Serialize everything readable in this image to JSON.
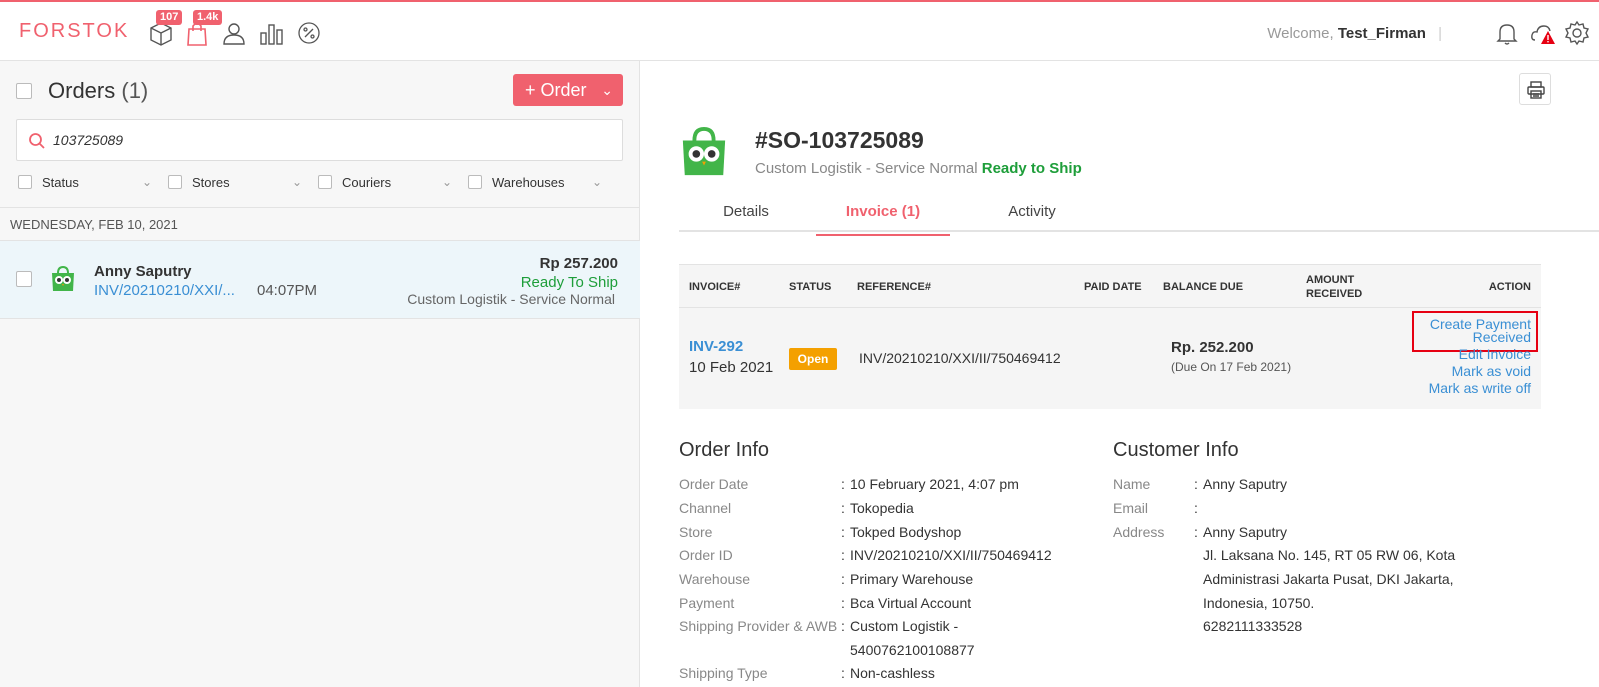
{
  "topbar": {
    "logo": "FORSTOK",
    "badges": {
      "products": "107",
      "orders": "1.4k"
    },
    "welcome_prefix": "Welcome,",
    "user": "Test_Firman",
    "separator": "|"
  },
  "left": {
    "title": "Orders",
    "count": "(1)",
    "order_button": "+ Order",
    "search_value": "103725089",
    "filters": [
      "Status",
      "Stores",
      "Couriers",
      "Warehouses"
    ],
    "date_header": "WEDNESDAY, FEB 10, 2021",
    "order": {
      "customer": "Anny Saputry",
      "invoice": "INV/20210210/XXI/...",
      "time": "04:07PM",
      "amount": "Rp 257.200",
      "status": "Ready To Ship",
      "shipping": "Custom Logistik - Service Normal"
    }
  },
  "detail": {
    "so_number": "#SO-103725089",
    "subtitle": "Custom Logistik - Service Normal",
    "status": "Ready to Ship",
    "tabs": [
      "Details",
      "Invoice (1)",
      "Activity"
    ],
    "invoice_table": {
      "headers": {
        "invoice": "INVOICE#",
        "status": "STATUS",
        "reference": "REFERENCE#",
        "paid_date": "PAID DATE",
        "balance_due": "BALANCE DUE",
        "amount_received_1": "AMOUNT",
        "amount_received_2": "RECEIVED",
        "action": "ACTION"
      },
      "row": {
        "invoice": "INV-292",
        "date": "10 Feb 2021",
        "status": "Open",
        "reference": "INV/20210210/XXI/II/750469412",
        "balance": "Rp. 252.200",
        "due": "(Due On 17 Feb 2021)",
        "actions": {
          "create_1": "Create Payment",
          "create_2": "Received",
          "edit": "Edit Invoice",
          "void": "Mark as void",
          "writeoff": "Mark as write off"
        }
      }
    },
    "order_info": {
      "title": "Order Info",
      "rows": [
        {
          "label": "Order Date",
          "value": "10 February 2021, 4:07 pm"
        },
        {
          "label": "Channel",
          "value": "Tokopedia"
        },
        {
          "label": "Store",
          "value": "Tokped Bodyshop"
        },
        {
          "label": "Order ID",
          "value": "INV/20210210/XXI/II/750469412"
        },
        {
          "label": "Warehouse",
          "value": "Primary Warehouse"
        },
        {
          "label": "Payment",
          "value": "Bca Virtual Account"
        },
        {
          "label": "Shipping Provider & AWB",
          "value": "Custom Logistik -",
          "value2": "5400762100108877"
        },
        {
          "label": "Shipping Type",
          "value": "Non-cashless"
        }
      ]
    },
    "customer_info": {
      "title": "Customer Info",
      "name_label": "Name",
      "name": "Anny Saputry",
      "email_label": "Email",
      "email": "",
      "address_label": "Address",
      "address_lines": [
        "Anny Saputry",
        "Jl. Laksana No. 145, RT 05 RW 06, Kota",
        "Administrasi Jakarta Pusat, DKI Jakarta,",
        "Indonesia, 10750.",
        "6282111333528"
      ]
    }
  }
}
